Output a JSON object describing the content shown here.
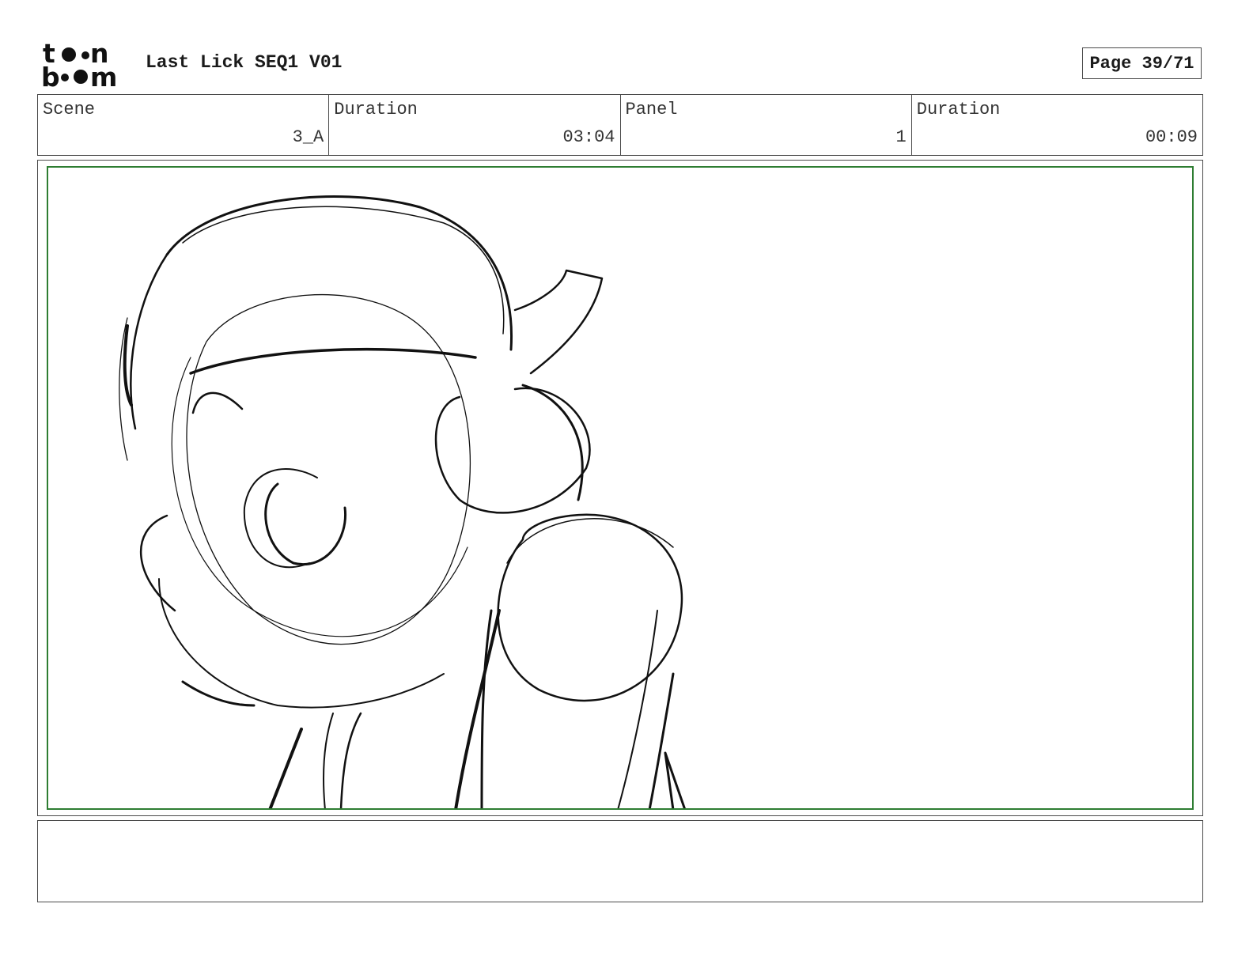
{
  "header": {
    "logo_lines": [
      "toon",
      "boom"
    ],
    "project_title": "Last Lick SEQ1 V01",
    "page_label": "Page 39/71"
  },
  "info": {
    "scene_label": "Scene",
    "scene_value": "3_A",
    "scene_duration_label": "Duration",
    "scene_duration_value": "03:04",
    "panel_label": "Panel",
    "panel_value": "1",
    "panel_duration_label": "Duration",
    "panel_duration_value": "00:09"
  },
  "panel": {
    "frame_color": "#2e7d32",
    "sketch_color": "#111111"
  },
  "caption": {
    "text": ""
  }
}
